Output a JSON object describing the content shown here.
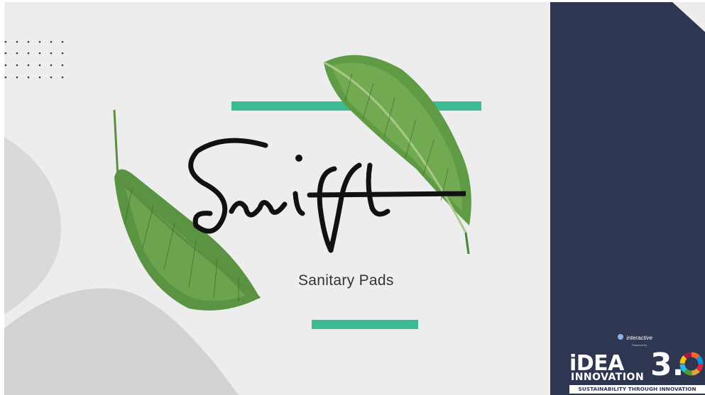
{
  "brand": {
    "logo_text": "Swift",
    "subtitle": "Sanitary Pads"
  },
  "sponsor": {
    "name": "interactive",
    "powered_by": "Powered by"
  },
  "event": {
    "idea": "iDEA",
    "innovation": "INNOVATION",
    "version": "3.",
    "tagline": "SUSTAINABILITY THROUGH INNOVATION"
  },
  "colors": {
    "background": "#ededed",
    "panel": "#2e3652",
    "accent_bar": "#3dbb95",
    "leaf": "#4f8a3c",
    "shape_gray": "#cfcfcf"
  },
  "icons": [
    "dot-grid-decoration",
    "banana-leaf-top",
    "banana-leaf-bottom",
    "sdg-ring-icon",
    "sponsor-logo-icon"
  ]
}
